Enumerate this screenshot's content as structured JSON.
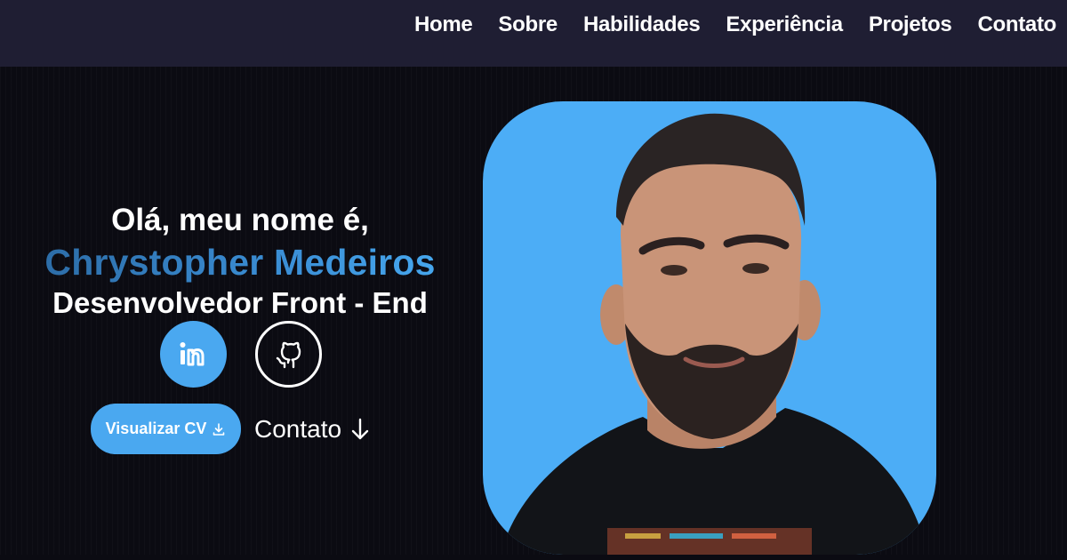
{
  "nav": {
    "items": [
      {
        "label": "Home"
      },
      {
        "label": "Sobre"
      },
      {
        "label": "Habilidades"
      },
      {
        "label": "Experiência"
      },
      {
        "label": "Projetos"
      },
      {
        "label": "Contato"
      }
    ]
  },
  "hero": {
    "greeting": "Olá, meu nome é,",
    "name": "Chrystopher Medeiros",
    "role": "Desenvolvedor Front - End",
    "social": [
      {
        "icon": "linkedin-icon"
      },
      {
        "icon": "github-icon"
      }
    ],
    "cv_button": "Visualizar CV",
    "contact_link": "Contato"
  },
  "colors": {
    "accent": "#4aa8f0",
    "navbar": "#1f1e33",
    "background": "#0b0b12",
    "name_gradient_start": "#2a67a0",
    "name_gradient_end": "#49aef5"
  }
}
